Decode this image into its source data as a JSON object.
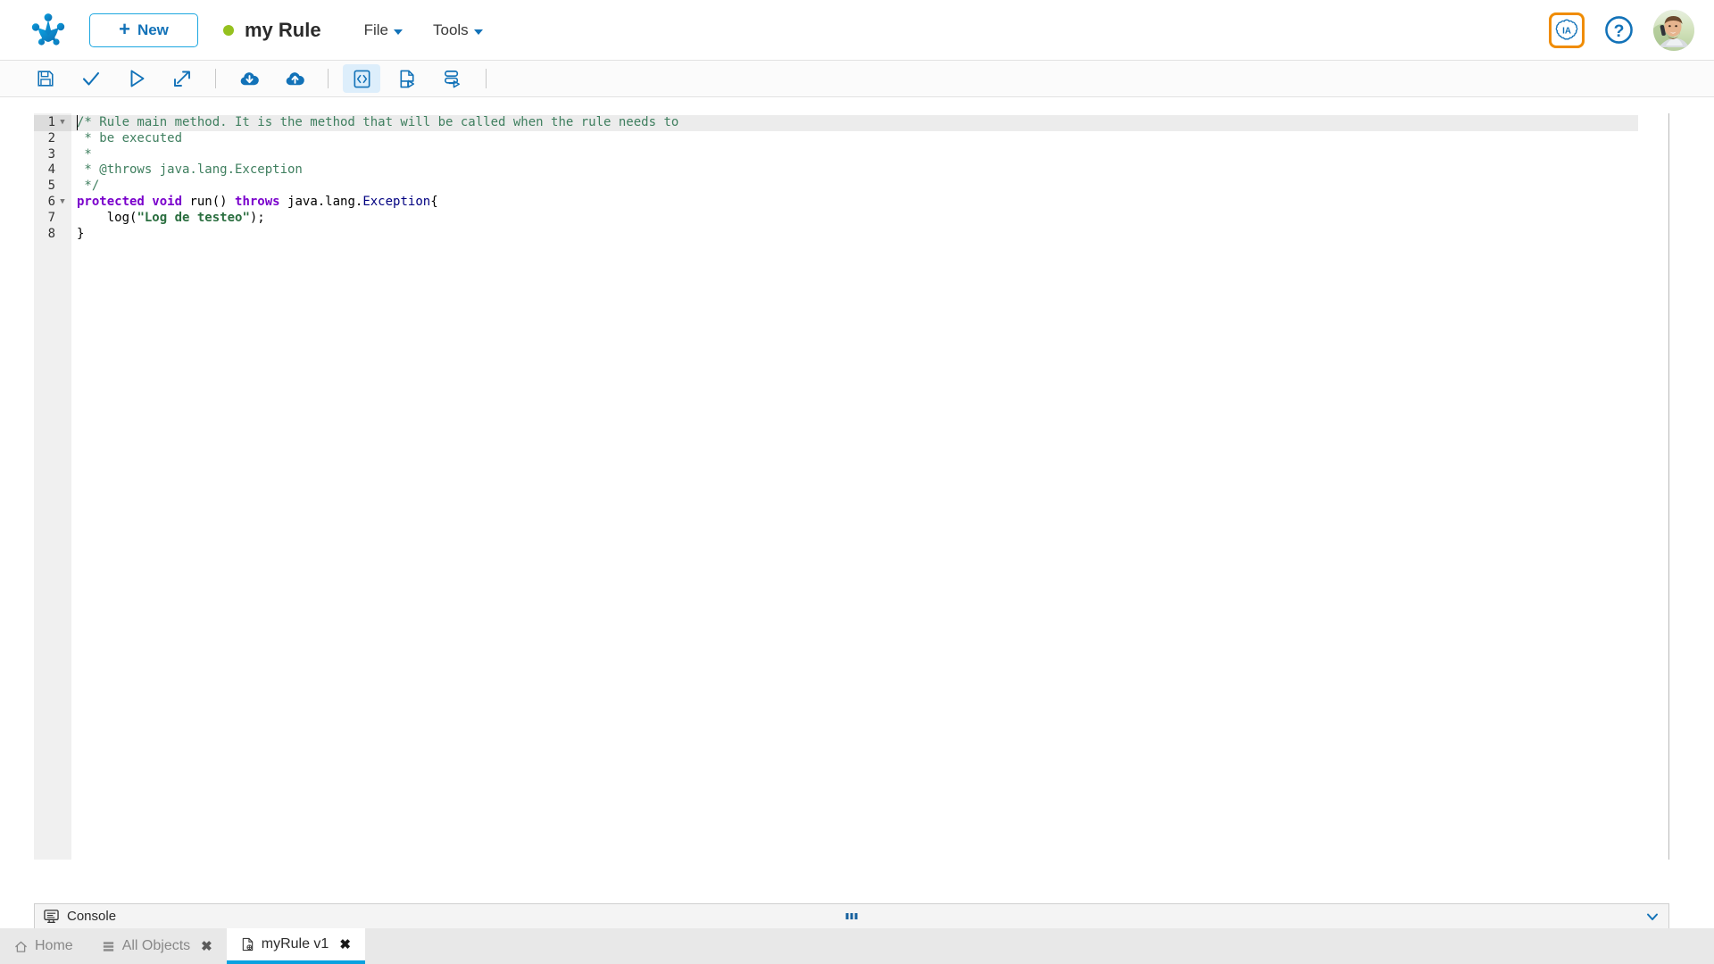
{
  "header": {
    "logo_icon": "bonita-frog-logo-icon",
    "new_button_label": "New",
    "new_button_plus": "+",
    "status_dot_color": "#95c11f",
    "document_title": "my Rule",
    "menus": [
      {
        "label": "File",
        "icon": "chevron-down-icon"
      },
      {
        "label": "Tools",
        "icon": "chevron-down-icon"
      }
    ],
    "ia_badge_label": "IA",
    "ia_badge_border_color": "#f08c00",
    "help_icon": "question-mark-circle-icon",
    "avatar_icon": "user-avatar-photo"
  },
  "toolbar": {
    "buttons": [
      {
        "name": "save-button",
        "icon": "floppy-disk-icon",
        "active": false
      },
      {
        "name": "validate-button",
        "icon": "checkmark-icon",
        "active": false
      },
      {
        "name": "run-button",
        "icon": "play-triangle-icon",
        "active": false
      },
      {
        "name": "open-external-button",
        "icon": "external-link-icon",
        "active": false
      },
      {
        "name": "import-button",
        "icon": "cloud-download-icon",
        "active": false
      },
      {
        "name": "export-button",
        "icon": "cloud-upload-icon",
        "active": false
      },
      {
        "name": "source-code-button",
        "icon": "code-document-icon",
        "active": true
      },
      {
        "name": "run-document-button",
        "icon": "document-play-icon",
        "active": false
      },
      {
        "name": "run-batch-button",
        "icon": "stacked-list-play-icon",
        "active": false
      }
    ]
  },
  "editor": {
    "accent_color": "#1272b8",
    "lines": [
      {
        "number": "1",
        "fold": true,
        "highlighted": true,
        "tokens": [
          {
            "cls": "tok-comment",
            "text": "/* Rule main method. It is the method that will be called when the rule needs to"
          }
        ]
      },
      {
        "number": "2",
        "fold": false,
        "highlighted": false,
        "tokens": [
          {
            "cls": "tok-comment",
            "text": " * be executed"
          }
        ]
      },
      {
        "number": "3",
        "fold": false,
        "highlighted": false,
        "tokens": [
          {
            "cls": "tok-comment",
            "text": " *"
          }
        ]
      },
      {
        "number": "4",
        "fold": false,
        "highlighted": false,
        "tokens": [
          {
            "cls": "tok-comment",
            "text": " * @throws java.lang.Exception"
          }
        ]
      },
      {
        "number": "5",
        "fold": false,
        "highlighted": false,
        "tokens": [
          {
            "cls": "tok-comment",
            "text": " */"
          }
        ]
      },
      {
        "number": "6",
        "fold": true,
        "highlighted": false,
        "tokens": [
          {
            "cls": "tok-kw",
            "text": "protected void "
          },
          {
            "cls": "tok-plain",
            "text": "run() "
          },
          {
            "cls": "tok-kw",
            "text": "throws "
          },
          {
            "cls": "tok-plain",
            "text": "java.lang."
          },
          {
            "cls": "tok-type",
            "text": "Exception"
          },
          {
            "cls": "tok-plain",
            "text": "{"
          }
        ]
      },
      {
        "number": "7",
        "fold": false,
        "highlighted": false,
        "tokens": [
          {
            "cls": "tok-plain",
            "text": "    log("
          },
          {
            "cls": "tok-str",
            "text": "\"Log de testeo\""
          },
          {
            "cls": "tok-plain",
            "text": ");"
          }
        ]
      },
      {
        "number": "8",
        "fold": false,
        "highlighted": false,
        "tokens": [
          {
            "cls": "tok-plain",
            "text": "}"
          }
        ]
      }
    ]
  },
  "console": {
    "label": "Console",
    "icon": "console-monitor-icon",
    "grip_icon": "drag-handle-dots-icon",
    "collapse_icon": "chevron-down-icon"
  },
  "tabs": [
    {
      "label": "Home",
      "icon": "home-icon",
      "closable": false,
      "active": false,
      "close_label": "✖"
    },
    {
      "label": "All Objects",
      "icon": "list-stack-icon",
      "closable": true,
      "active": false,
      "close_label": "✖"
    },
    {
      "label": "myRule v1",
      "icon": "rule-document-icon",
      "closable": true,
      "active": true,
      "close_label": "✖"
    }
  ]
}
